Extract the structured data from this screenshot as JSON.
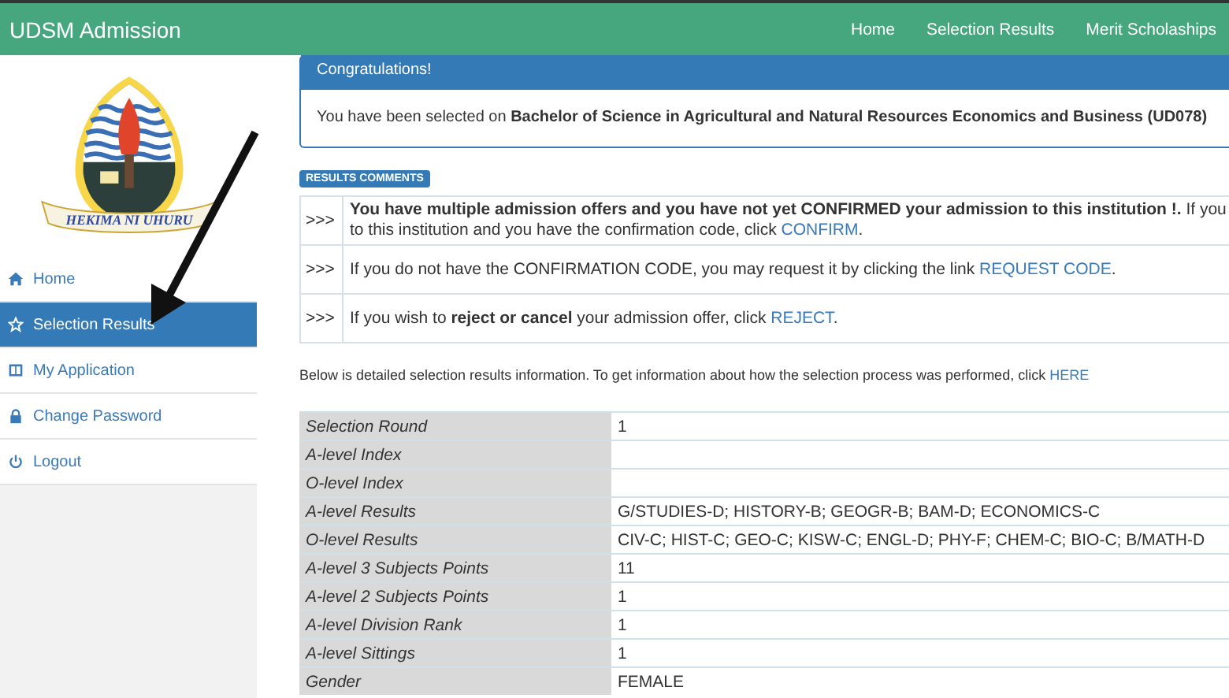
{
  "navbar": {
    "brand": "UDSM Admission",
    "links": [
      "Home",
      "Selection Results",
      "Merit Scholaships"
    ]
  },
  "logo": {
    "motto": "HEKIMA NI UHURU"
  },
  "sidebar": {
    "items": [
      {
        "label": "Home",
        "kind": "home",
        "selected": false
      },
      {
        "label": "Selection Results",
        "kind": "results",
        "selected": true
      },
      {
        "label": "My Application",
        "kind": "application",
        "selected": false
      },
      {
        "label": "Change Password",
        "kind": "password",
        "selected": false
      },
      {
        "label": "Logout",
        "kind": "logout",
        "selected": false
      }
    ]
  },
  "panel": {
    "heading": "Congratulations!",
    "body": "You have been selected on **Bachelor of Science in Agricultural and Natural Resources Economics and Business (UD078)**"
  },
  "comments_badge": "RESULTS COMMENTS",
  "comments": [
    {
      "marker": ">>>",
      "lines": [
        "**You have multiple admission offers and you have not yet CONFIRMED your admission to this institution !.** If you",
        "to this institution and you have the confirmation code, click"
      ],
      "link": "CONFIRM",
      "end": "."
    },
    {
      "marker": ">>>",
      "lines": [
        "If you do not have the CONFIRMATION CODE, you may request it by clicking the link"
      ],
      "link": "REQUEST CODE",
      "end": "."
    },
    {
      "marker": ">>>",
      "lines": [
        "If you wish to **reject or cancel** your admission offer, click"
      ],
      "link": "REJECT",
      "end": "."
    }
  ],
  "info": {
    "text": "Below is detailed selection results information. To get information about how the selection process was performed, click",
    "link": "HERE"
  },
  "table": {
    "rows": [
      {
        "label": "Selection Round",
        "value": "1"
      },
      {
        "label": "A-level Index",
        "value": ""
      },
      {
        "label": "O-level Index",
        "value": ""
      },
      {
        "label": "A-level Results",
        "value": "G/STUDIES-D; HISTORY-B; GEOGR-B; BAM-D; ECONOMICS-C"
      },
      {
        "label": "O-level Results",
        "value": "CIV-C; HIST-C; GEO-C; KISW-C; ENGL-D; PHY-F; CHEM-C; BIO-C; B/MATH-D"
      },
      {
        "label": "A-level 3 Subjects Points",
        "value": "11"
      },
      {
        "label": "A-level 2 Subjects Points",
        "value": "1"
      },
      {
        "label": "A-level Division Rank",
        "value": "1"
      },
      {
        "label": "A-level Sittings",
        "value": "1"
      },
      {
        "label": "Gender",
        "value": "FEMALE"
      }
    ]
  }
}
